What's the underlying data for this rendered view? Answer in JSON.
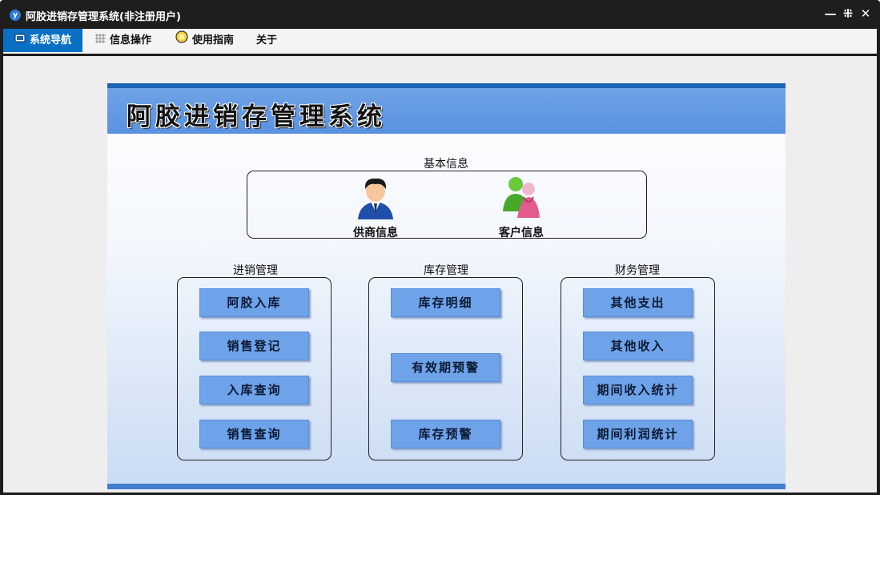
{
  "window": {
    "title": "阿胶进销存管理系统(非注册用户)",
    "app_icon_glyph": "y",
    "controls": {
      "minimize": "—",
      "restore": "⁜",
      "close": "✕"
    }
  },
  "tabs": [
    {
      "label": "系统导航",
      "icon": "monitor-icon",
      "active": true
    },
    {
      "label": "信息操作",
      "icon": "grid-icon",
      "active": false
    },
    {
      "label": "使用指南",
      "icon": "bulb-icon",
      "active": false
    },
    {
      "label": "关于",
      "icon": "",
      "active": false
    }
  ],
  "banner": {
    "title": "阿胶进销存管理系统"
  },
  "basic_info": {
    "label": "基本信息",
    "items": [
      {
        "label": "供商信息",
        "icon": "supplier-person-icon"
      },
      {
        "label": "客户信息",
        "icon": "customer-people-icon"
      }
    ]
  },
  "groups": {
    "sales": {
      "label": "进销管理",
      "buttons": [
        "阿胶入库",
        "销售登记",
        "入库查询",
        "销售查询"
      ]
    },
    "inventory": {
      "label": "库存管理",
      "buttons": [
        "库存明细",
        "有效期预警",
        "库存预警"
      ]
    },
    "finance": {
      "label": "财务管理",
      "buttons": [
        "其他支出",
        "其他收入",
        "期间收入统计",
        "期间利润统计"
      ]
    }
  },
  "colors": {
    "accent": "#0a70c6",
    "banner": "#5a92e0",
    "button": "#6ea2e9",
    "titlebar": "#1e1e1e"
  }
}
